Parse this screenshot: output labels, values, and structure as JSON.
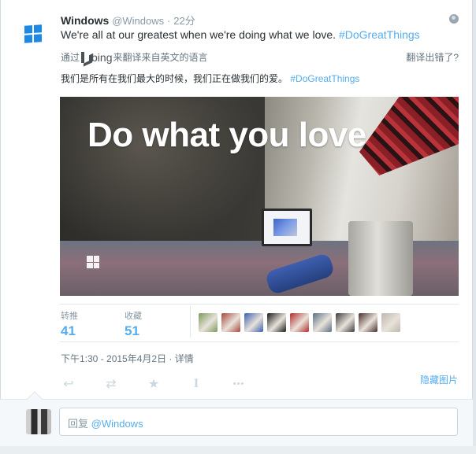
{
  "tweet": {
    "author_name": "Windows",
    "author_handle": "@Windows",
    "separator": "·",
    "time": "22分",
    "text": "We're all at our greatest when we're doing what we love.",
    "hashtag": "#DoGreatThings"
  },
  "translation": {
    "prefix": "通过",
    "bing_label": "bing",
    "suffix": "来翻译来自英文的语言",
    "wrong_link": "翻译出错了?",
    "text": "我们是所有在我们最大的时候，我们正在做我们的爱。",
    "hashtag": "#DoGreatThings"
  },
  "media": {
    "headline": "Do what you love",
    "hide_label": "隐藏图片"
  },
  "stats": {
    "retweets_label": "转推",
    "retweets_count": "41",
    "favorites_label": "收藏",
    "favorites_count": "51"
  },
  "favoriters": [
    {
      "icon": "avatar-person-green",
      "color": "#7a9a5a"
    },
    {
      "icon": "avatar-person-red",
      "color": "#a8463c"
    },
    {
      "icon": "avatar-blue-graphic",
      "color": "#3a5fb0"
    },
    {
      "icon": "avatar-black-mascot",
      "color": "#1b1b1b"
    },
    {
      "icon": "avatar-red-banner",
      "color": "#b32a2a"
    },
    {
      "icon": "avatar-group-photo",
      "color": "#5a6f86"
    },
    {
      "icon": "avatar-glasses-man",
      "color": "#3d3d3d"
    },
    {
      "icon": "avatar-woman-dark",
      "color": "#4a2f2a"
    },
    {
      "icon": "avatar-eye-closeup",
      "color": "#bfb7ae"
    }
  ],
  "datetime": "下午1:30 - 2015年4月2日 · 详情",
  "actions": [
    {
      "icon": "reply-icon",
      "glyph": "↩"
    },
    {
      "icon": "retweet-icon",
      "glyph": "⇄"
    },
    {
      "icon": "favorite-star-icon",
      "glyph": "★"
    },
    {
      "icon": "text-cursor-icon",
      "glyph": "I"
    },
    {
      "icon": "more-dots-icon",
      "glyph": "•••"
    }
  ],
  "reply": {
    "prefix": "回复",
    "mention": "@Windows"
  },
  "colors": {
    "link": "#55acee",
    "muted": "#8899a6",
    "windows_blue": "#1e88e5"
  }
}
